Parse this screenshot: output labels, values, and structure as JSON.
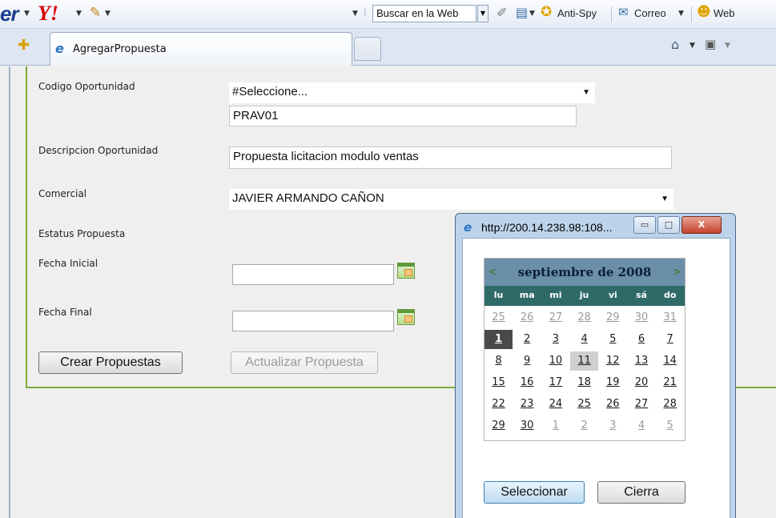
{
  "toolbar": {
    "brand_fragment": "er",
    "yahoo_logo": "Y!",
    "search_text": "Buscar en la Web",
    "antispy": "Anti-Spy",
    "correo": "Correo",
    "web": "Web"
  },
  "tab": {
    "title": "AgregarPropuesta"
  },
  "form": {
    "codigo_label": "Codigo Oportunidad",
    "codigo_select": "#Seleccione...",
    "codigo_value": "PRAV01",
    "descripcion_label": "Descripcion Oportunidad",
    "descripcion_value": "Propuesta licitacion modulo ventas",
    "comercial_label": "Comercial",
    "comercial_value": "JAVIER ARMANDO CAÑON",
    "estatus_label": "Estatus Propuesta",
    "fecha_inicial_label": "Fecha Inicial",
    "fecha_final_label": "Fecha Final",
    "crear_button": "Crear Propuestas",
    "actualizar_button": "Actualizar Propuesta"
  },
  "popup": {
    "title": "http://200.14.238.98:108...",
    "minimize": "▭",
    "maximize": "□",
    "close": "X",
    "seleccionar": "Seleccionar",
    "cierra": "Cierra"
  },
  "calendar": {
    "title": "septiembre de 2008",
    "prev": "<",
    "next": ">",
    "weekdays": [
      "lu",
      "ma",
      "mi",
      "ju",
      "vi",
      "sá",
      "do"
    ],
    "weeks": [
      [
        {
          "d": "25",
          "t": "other"
        },
        {
          "d": "26",
          "t": "other"
        },
        {
          "d": "27",
          "t": "other"
        },
        {
          "d": "28",
          "t": "other"
        },
        {
          "d": "29",
          "t": "other"
        },
        {
          "d": "30",
          "t": "other"
        },
        {
          "d": "31",
          "t": "other"
        }
      ],
      [
        {
          "d": "1",
          "t": "selected"
        },
        {
          "d": "2",
          "t": ""
        },
        {
          "d": "3",
          "t": ""
        },
        {
          "d": "4",
          "t": ""
        },
        {
          "d": "5",
          "t": ""
        },
        {
          "d": "6",
          "t": ""
        },
        {
          "d": "7",
          "t": ""
        }
      ],
      [
        {
          "d": "8",
          "t": ""
        },
        {
          "d": "9",
          "t": ""
        },
        {
          "d": "10",
          "t": ""
        },
        {
          "d": "11",
          "t": "today"
        },
        {
          "d": "12",
          "t": ""
        },
        {
          "d": "13",
          "t": ""
        },
        {
          "d": "14",
          "t": ""
        }
      ],
      [
        {
          "d": "15",
          "t": ""
        },
        {
          "d": "16",
          "t": ""
        },
        {
          "d": "17",
          "t": ""
        },
        {
          "d": "18",
          "t": ""
        },
        {
          "d": "19",
          "t": ""
        },
        {
          "d": "20",
          "t": ""
        },
        {
          "d": "21",
          "t": ""
        }
      ],
      [
        {
          "d": "22",
          "t": ""
        },
        {
          "d": "23",
          "t": ""
        },
        {
          "d": "24",
          "t": ""
        },
        {
          "d": "25",
          "t": ""
        },
        {
          "d": "26",
          "t": ""
        },
        {
          "d": "27",
          "t": ""
        },
        {
          "d": "28",
          "t": ""
        }
      ],
      [
        {
          "d": "29",
          "t": ""
        },
        {
          "d": "30",
          "t": ""
        },
        {
          "d": "1",
          "t": "other"
        },
        {
          "d": "2",
          "t": "other"
        },
        {
          "d": "3",
          "t": "other"
        },
        {
          "d": "4",
          "t": "other"
        },
        {
          "d": "5",
          "t": "other"
        }
      ]
    ]
  }
}
